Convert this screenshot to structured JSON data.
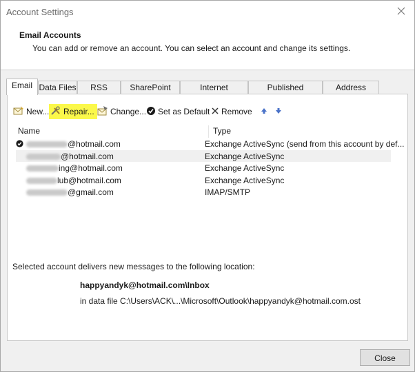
{
  "window": {
    "title": "Account Settings"
  },
  "header": {
    "title": "Email Accounts",
    "description": "You can add or remove an account. You can select an account and change its settings."
  },
  "tabs": [
    {
      "label": "Email"
    },
    {
      "label": "Data Files"
    },
    {
      "label": "RSS Feeds"
    },
    {
      "label": "SharePoint Lists"
    },
    {
      "label": "Internet Calendars"
    },
    {
      "label": "Published Calendars"
    },
    {
      "label": "Address Books"
    }
  ],
  "toolbar": {
    "new": "New...",
    "repair": "Repair...",
    "change": "Change...",
    "set_default": "Set as Default",
    "remove": "Remove",
    "highlight_color": "#fbf84a"
  },
  "list": {
    "col_name": "Name",
    "col_type": "Type",
    "rows": [
      {
        "name_visible": "@hotmail.com",
        "type": "Exchange ActiveSync (send from this account by def...",
        "default": true
      },
      {
        "name_visible": "@hotmail.com",
        "type": "Exchange ActiveSync",
        "selected": true
      },
      {
        "name_visible": "ing@hotmail.com",
        "type": "Exchange ActiveSync"
      },
      {
        "name_visible": "lub@hotmail.com",
        "type": "Exchange ActiveSync"
      },
      {
        "name_visible": "@gmail.com",
        "type": "IMAP/SMTP"
      }
    ]
  },
  "location": {
    "label": "Selected account delivers new messages to the following location:",
    "account": "happyandyk@hotmail.com\\Inbox",
    "data_file": "in data file C:\\Users\\ACK\\...\\Microsoft\\Outlook\\happyandyk@hotmail.com.ost"
  },
  "footer": {
    "close": "Close"
  },
  "icons": [
    "close-icon",
    "new-icon",
    "repair-icon",
    "change-icon",
    "set-default-icon",
    "remove-icon",
    "move-up-icon",
    "move-down-icon",
    "default-check-icon"
  ]
}
